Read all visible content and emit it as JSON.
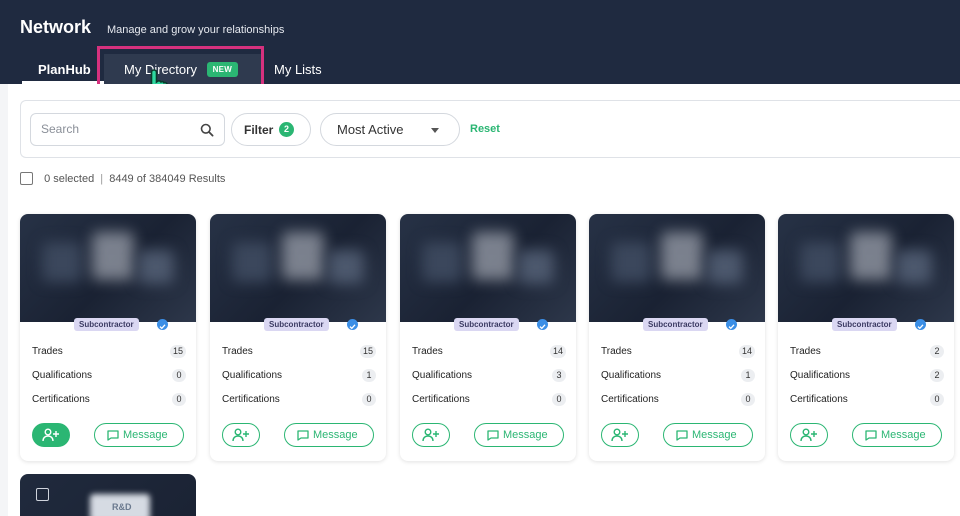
{
  "header": {
    "title": "Network",
    "subtitle": "Manage and grow your relationships",
    "tabs": [
      {
        "label": "PlanHub"
      },
      {
        "label": "My Directory",
        "badge": "NEW"
      },
      {
        "label": "My Lists"
      }
    ]
  },
  "toolbar": {
    "search_placeholder": "Search",
    "filter_label": "Filter",
    "filter_count": "2",
    "sort_value": "Most Active",
    "reset_label": "Reset"
  },
  "results": {
    "selected": "0 selected",
    "separator": "|",
    "summary": "8449 of 384049 Results"
  },
  "card_labels": {
    "tag": "Subcontractor",
    "trades": "Trades",
    "qualifications": "Qualifications",
    "certifications": "Certifications",
    "message": "Message"
  },
  "cards": [
    {
      "trades": "15",
      "qualifications": "0",
      "certifications": "0"
    },
    {
      "trades": "15",
      "qualifications": "1",
      "certifications": "0"
    },
    {
      "trades": "14",
      "qualifications": "3",
      "certifications": "0"
    },
    {
      "trades": "14",
      "qualifications": "1",
      "certifications": "0"
    },
    {
      "trades": "2",
      "qualifications": "2",
      "certifications": "0"
    }
  ],
  "partial_card": {
    "logo_text": "R&D"
  },
  "colors": {
    "header_bg": "#1f2a40",
    "accent_green": "#2bb673",
    "highlight_pink": "#d6317e",
    "tag_bg": "#dad7f2",
    "verified_blue": "#3a8ee6"
  },
  "icons": {
    "search": "search-icon",
    "add_user": "add-user-icon",
    "message": "message-icon",
    "verified": "verified-icon",
    "cursor": "hand-pointer-icon"
  }
}
